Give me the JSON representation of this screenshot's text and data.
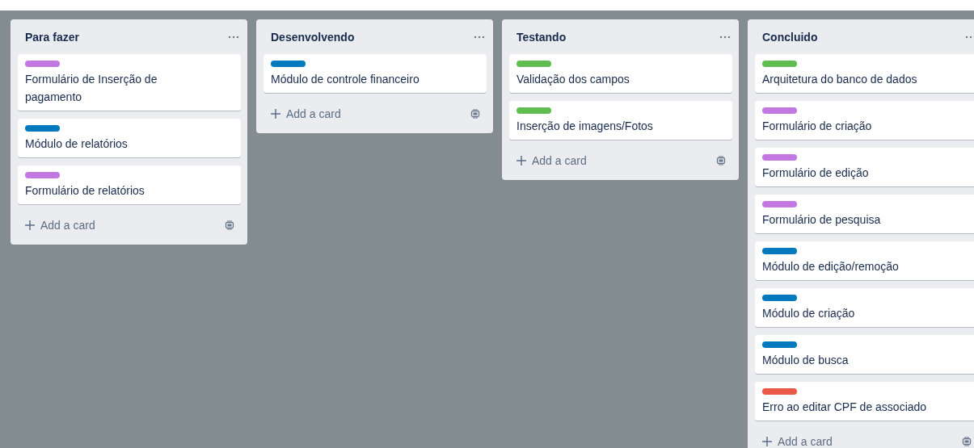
{
  "lists": [
    {
      "title": "Para fazer",
      "cards": [
        {
          "color": "#c377e0",
          "text": "Formulário de Inserção de pagamento"
        },
        {
          "color": "#0079bf",
          "text": "Módulo de relatórios"
        },
        {
          "color": "#c377e0",
          "text": "Formulário de relatórios"
        }
      ],
      "add_label": "Add a card"
    },
    {
      "title": "Desenvolvendo",
      "cards": [
        {
          "color": "#0079bf",
          "text": "Módulo de controle financeiro"
        }
      ],
      "add_label": "Add a card"
    },
    {
      "title": "Testando",
      "cards": [
        {
          "color": "#61bd4f",
          "text": "Validação dos campos"
        },
        {
          "color": "#61bd4f",
          "text": "Inserção de imagens/Fotos"
        }
      ],
      "add_label": "Add a card"
    },
    {
      "title": "Concluido",
      "cards": [
        {
          "color": "#61bd4f",
          "text": "Arquitetura do banco de dados"
        },
        {
          "color": "#c377e0",
          "text": "Formulário de criação"
        },
        {
          "color": "#c377e0",
          "text": "Formulário de edição"
        },
        {
          "color": "#c377e0",
          "text": "Formulário de pesquisa"
        },
        {
          "color": "#0079bf",
          "text": "Módulo de edição/remoção"
        },
        {
          "color": "#0079bf",
          "text": "Módulo de criação"
        },
        {
          "color": "#0079bf",
          "text": "Módulo de busca"
        },
        {
          "color": "#eb5a46",
          "text": "Erro ao editar CPF de associado"
        }
      ],
      "add_label": "Add a card"
    }
  ]
}
